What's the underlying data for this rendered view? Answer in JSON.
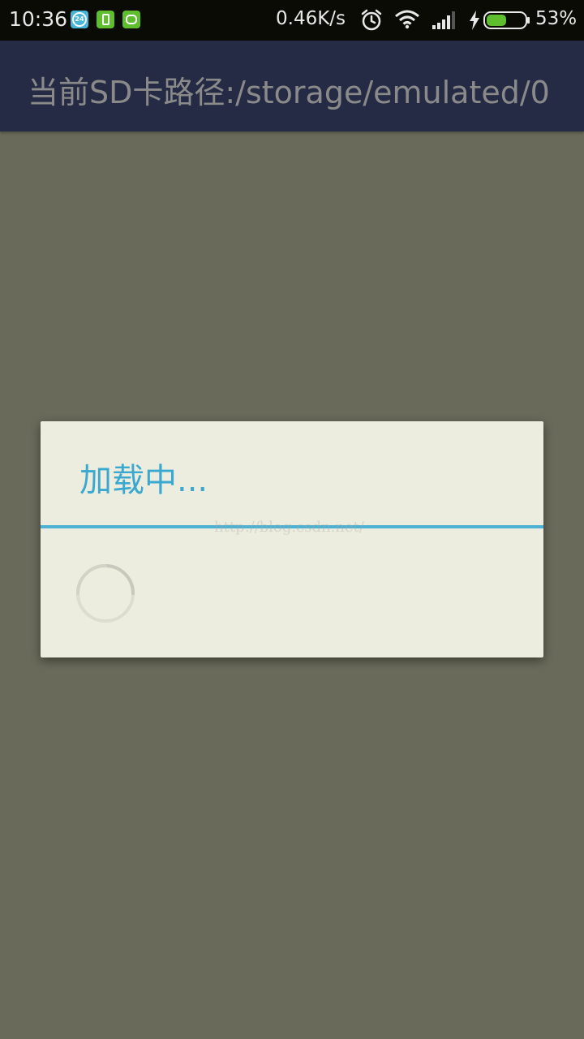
{
  "status_bar": {
    "time": "10:36",
    "notifications": [
      "24h-icon",
      "sim-card-icon",
      "cat-icon"
    ],
    "net_speed": "0.46K/s",
    "battery_percent": "53%",
    "battery_level": 0.53,
    "icons": [
      "alarm-icon",
      "wifi-icon",
      "signal-icon",
      "charging-icon",
      "battery-icon"
    ]
  },
  "app_bar": {
    "title": "当前SD卡路径:/storage/emulated/0"
  },
  "dialog": {
    "title": "加载中...",
    "watermark": "http://blog.csdn.net/"
  },
  "colors": {
    "status_bar_bg": "#0b0b06",
    "app_bar_bg": "#252b44",
    "screen_dim_bg": "#6a6a5a",
    "dialog_bg": "#ececdf",
    "accent": "#3ba9cf",
    "battery_fill": "#5fbe2e"
  }
}
